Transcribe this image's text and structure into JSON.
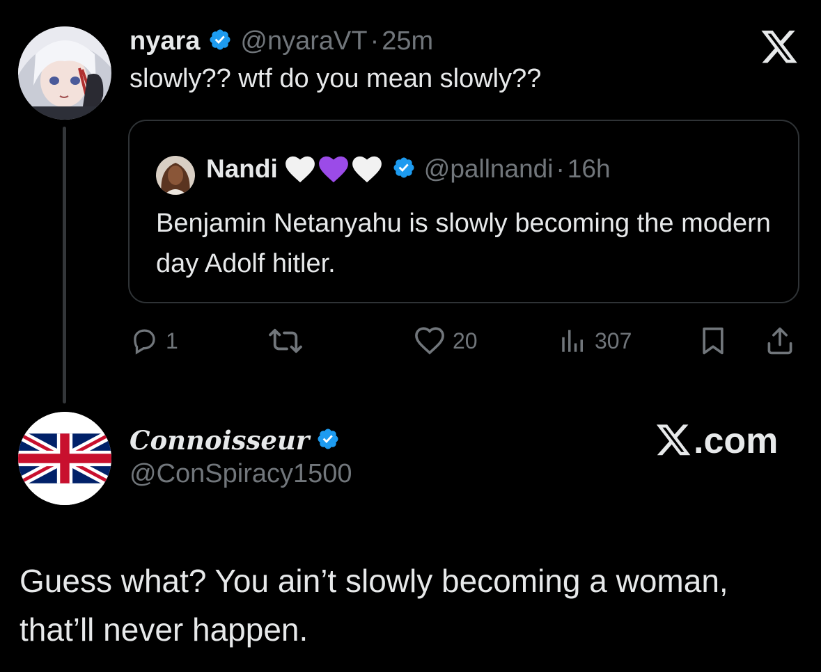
{
  "tweet": {
    "author": {
      "name": "nyara",
      "handle": "@nyaraVT",
      "separator": "·",
      "time": "25m"
    },
    "text": "slowly?? wtf do you mean slowly??",
    "quoted": {
      "author": {
        "name": "Nandi",
        "emojis": [
          "white-heart",
          "purple-heart",
          "white-heart"
        ],
        "handle": "@pallnandi",
        "separator": "·",
        "time": "16h"
      },
      "text": "Benjamin Netanyahu is slowly becoming the modern day Adolf hitler."
    },
    "actions": {
      "replies": "1",
      "likes": "20",
      "views": "307"
    }
  },
  "reply": {
    "author": {
      "name": "Connoisseur",
      "handle": "@ConSpiracy1500"
    },
    "watermark": ".com",
    "text": "Guess what? You ain’t slowly becoming a woman, that’ll never happen."
  },
  "colors": {
    "background": "#000000",
    "text": "#e7e9ea",
    "muted": "#71767b",
    "verified": "#1d9bf0",
    "border": "#2f3336"
  },
  "icons": [
    "x-logo",
    "verified-badge",
    "reply-icon",
    "retweet-icon",
    "like-icon",
    "views-icon",
    "bookmark-icon",
    "share-icon"
  ]
}
